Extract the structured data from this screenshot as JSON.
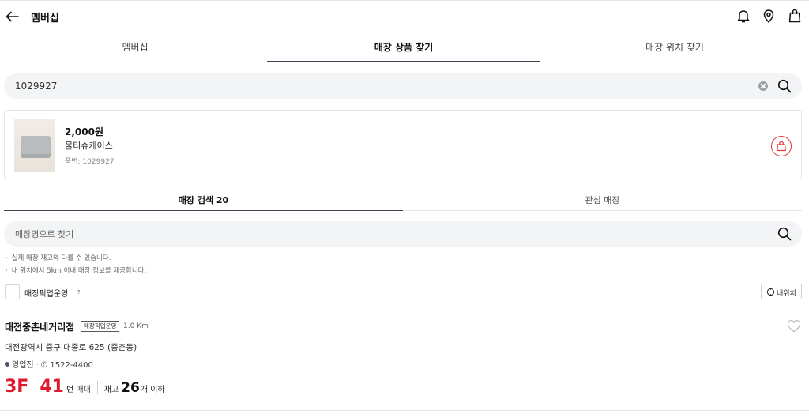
{
  "header": {
    "title": "멤버십",
    "icons": [
      "back-arrow-icon",
      "bell-icon",
      "location-pin-icon",
      "shopping-bag-icon"
    ]
  },
  "tabs": [
    {
      "label": "멤버십"
    },
    {
      "label": "매장 상품 찾기"
    },
    {
      "label": "매장 위치 찾기"
    }
  ],
  "search": {
    "value": "1029927"
  },
  "product": {
    "price": "2,000원",
    "name": "물티슈케이스",
    "code": "품번: 1029927"
  },
  "subtabs": [
    {
      "label": "매장 검색 20"
    },
    {
      "label": "관심 매장"
    }
  ],
  "store_search": {
    "placeholder": "매장명으로 찾기"
  },
  "notes": [
    "실제 매장 재고와 다를 수 있습니다.",
    "내 위치에서 5km 이내 매장 정보를 제공합니다."
  ],
  "filter": {
    "label": "매장픽업운영",
    "help": "?"
  },
  "location_button": {
    "label": "내위치"
  },
  "store": {
    "name": "대전중촌네거리점",
    "badge": "매장픽업운영",
    "distance": "1.0 Km",
    "address": "대전광역시 중구 대종로 625 (중촌동)",
    "status": "영업전",
    "phone": "1522-4400",
    "floor": "3F",
    "aisle_number": "41",
    "aisle_suffix": "번 매대",
    "stock_prefix": "재고",
    "stock_qty": "26",
    "stock_suffix": "개 이하"
  },
  "colors": {
    "accent_red": "#e0182d",
    "tab_underline": "#3b4453"
  }
}
